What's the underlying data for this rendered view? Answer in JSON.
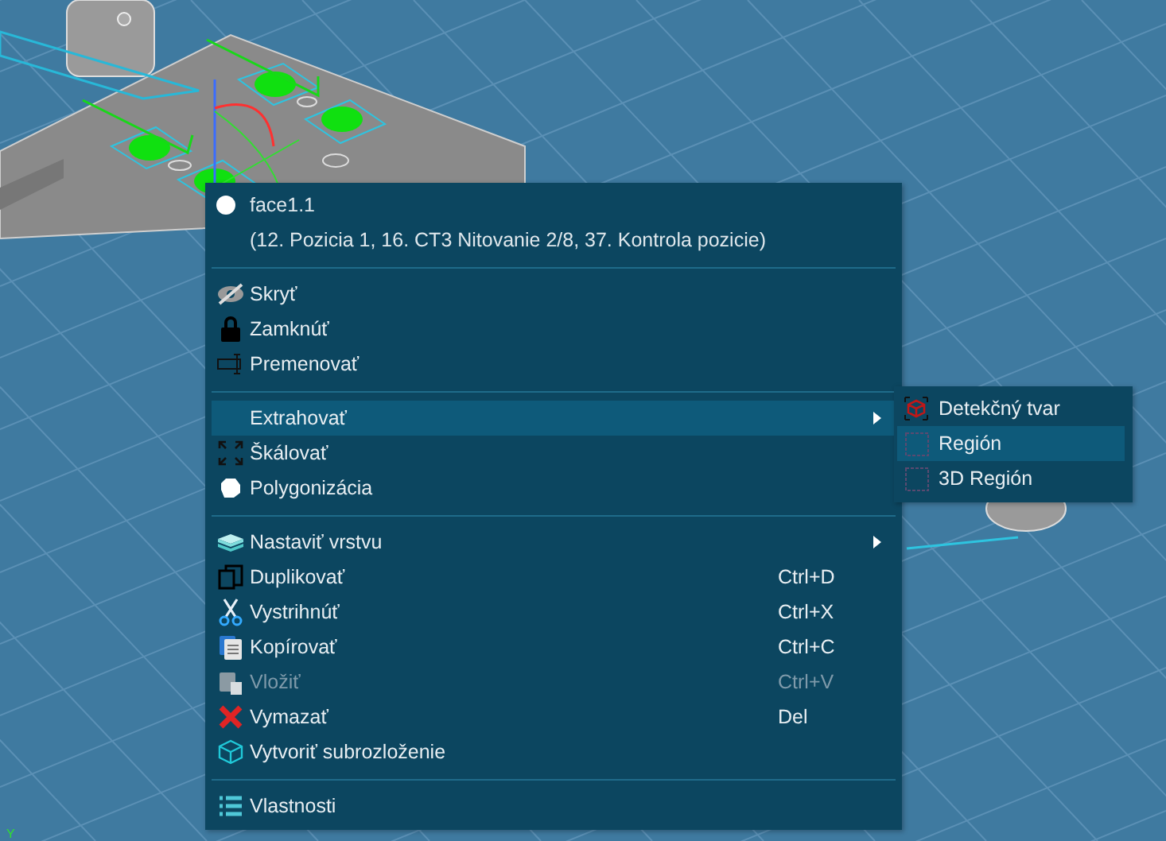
{
  "viewport": {
    "axis_label": "Y"
  },
  "context_menu": {
    "header": {
      "title": "face1.1",
      "subtitle": "(12. Pozicia 1, 16. CT3 Nitovanie 2/8, 37. Kontrola pozicie)"
    },
    "sections": [
      {
        "items": [
          {
            "label": "Skryť",
            "selected": false,
            "disabled": false,
            "submenu": false
          },
          {
            "label": "Zamknúť",
            "selected": false,
            "disabled": false,
            "submenu": false
          },
          {
            "label": "Premenovať",
            "selected": false,
            "disabled": false,
            "submenu": false
          }
        ]
      },
      {
        "items": [
          {
            "label": "Extrahovať",
            "selected": true,
            "disabled": false,
            "submenu": true
          },
          {
            "label": "Škálovať",
            "selected": false,
            "disabled": false,
            "submenu": false
          },
          {
            "label": "Polygonizácia",
            "selected": false,
            "disabled": false,
            "submenu": false
          }
        ]
      },
      {
        "items": [
          {
            "label": "Nastaviť vrstvu",
            "selected": false,
            "disabled": false,
            "submenu": true
          },
          {
            "label": "Duplikovať",
            "shortcut": "Ctrl+D",
            "selected": false,
            "disabled": false,
            "submenu": false
          },
          {
            "label": "Vystrihnúť",
            "shortcut": "Ctrl+X",
            "selected": false,
            "disabled": false,
            "submenu": false
          },
          {
            "label": "Kopírovať",
            "shortcut": "Ctrl+C",
            "selected": false,
            "disabled": false,
            "submenu": false
          },
          {
            "label": "Vložiť",
            "shortcut": "Ctrl+V",
            "selected": false,
            "disabled": true,
            "submenu": false
          },
          {
            "label": "Vymazať",
            "shortcut": "Del",
            "selected": false,
            "disabled": false,
            "submenu": false
          },
          {
            "label": "Vytvoriť subrozloženie",
            "selected": false,
            "disabled": false,
            "submenu": false
          }
        ]
      },
      {
        "items": [
          {
            "label": "Vlastnosti",
            "selected": false,
            "disabled": false,
            "submenu": false
          }
        ]
      }
    ]
  },
  "submenu": {
    "items": [
      {
        "label": "Detekčný tvar",
        "selected": false
      },
      {
        "label": "Región",
        "selected": true
      },
      {
        "label": "3D Región",
        "selected": false
      }
    ]
  }
}
